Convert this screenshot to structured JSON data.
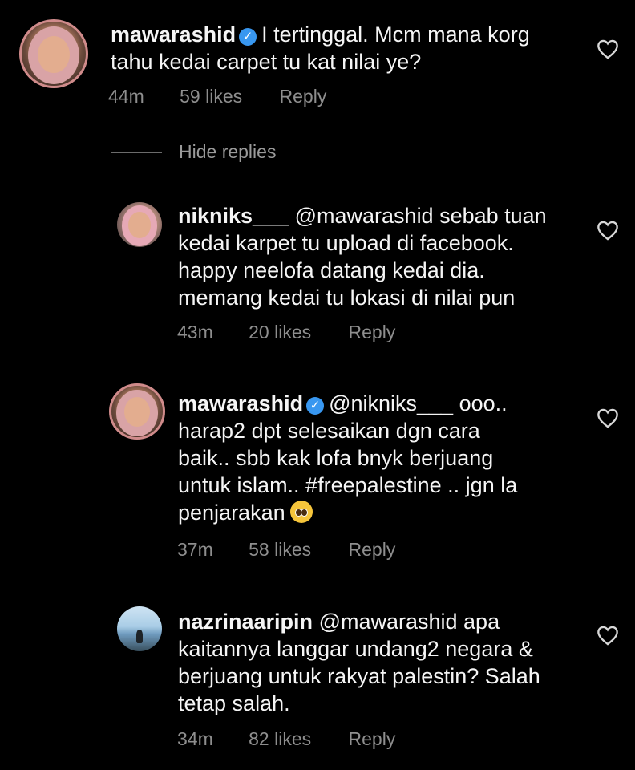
{
  "main_comment": {
    "username": "mawarashid",
    "text": "I tertinggal. Mcm mana korg",
    "text_line2": "tahu kedai carpet tu kat nilai ye?",
    "time": "44m",
    "likes": "59 likes",
    "reply": "Reply"
  },
  "hide_replies": "Hide replies",
  "replies": [
    {
      "username": "nikniks___",
      "lines": [
        "@mawarashid sebab tuan",
        "kedai karpet tu upload di facebook.",
        "happy neelofa datang kedai dia.",
        "memang kedai tu lokasi di nilai pun"
      ],
      "time": "43m",
      "likes": "20 likes",
      "reply": "Reply"
    },
    {
      "username": "mawarashid",
      "lines": [
        "@nikniks___ ooo..",
        "harap2 dpt selesaikan dgn cara",
        "baik.. sbb kak lofa bnyk berjuang",
        "untuk islam.. #freepalestine .. jgn la",
        "penjarakan"
      ],
      "time": "37m",
      "likes": "58 likes",
      "reply": "Reply"
    },
    {
      "username": "nazrinaaripin",
      "lines": [
        "@mawarashid apa",
        "kaitannya langgar undang2 negara &",
        "berjuang untuk rakyat palestin? Salah",
        "tetap salah."
      ],
      "time": "34m",
      "likes": "82 likes",
      "reply": "Reply"
    }
  ],
  "icons": {
    "verified": "verified-badge-icon",
    "like": "heart-icon",
    "emoji": "pleading-face-emoji"
  },
  "colors": {
    "background": "#000000",
    "text": "#f5f5f5",
    "meta": "#8e8e8e",
    "verified": "#3897f0"
  }
}
